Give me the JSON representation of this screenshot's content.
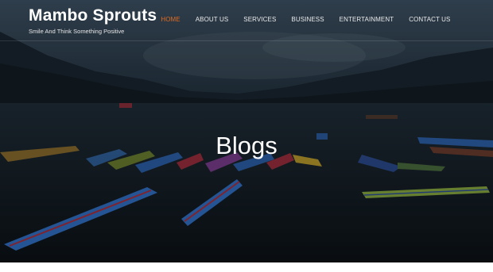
{
  "site": {
    "title": "Mambo Sprouts",
    "tagline": "Smile And Think Something Positive"
  },
  "nav": {
    "items": [
      {
        "label": "HOME",
        "active": true
      },
      {
        "label": "ABOUT US",
        "active": false
      },
      {
        "label": "SERVICES",
        "active": false
      },
      {
        "label": "BUSINESS",
        "active": false
      },
      {
        "label": "ENTERTAINMENT",
        "active": false
      },
      {
        "label": "CONTACT US",
        "active": false
      }
    ]
  },
  "hero": {
    "heading": "Blogs"
  },
  "colors": {
    "accent": "#e06a1c",
    "text": "#ffffff"
  }
}
